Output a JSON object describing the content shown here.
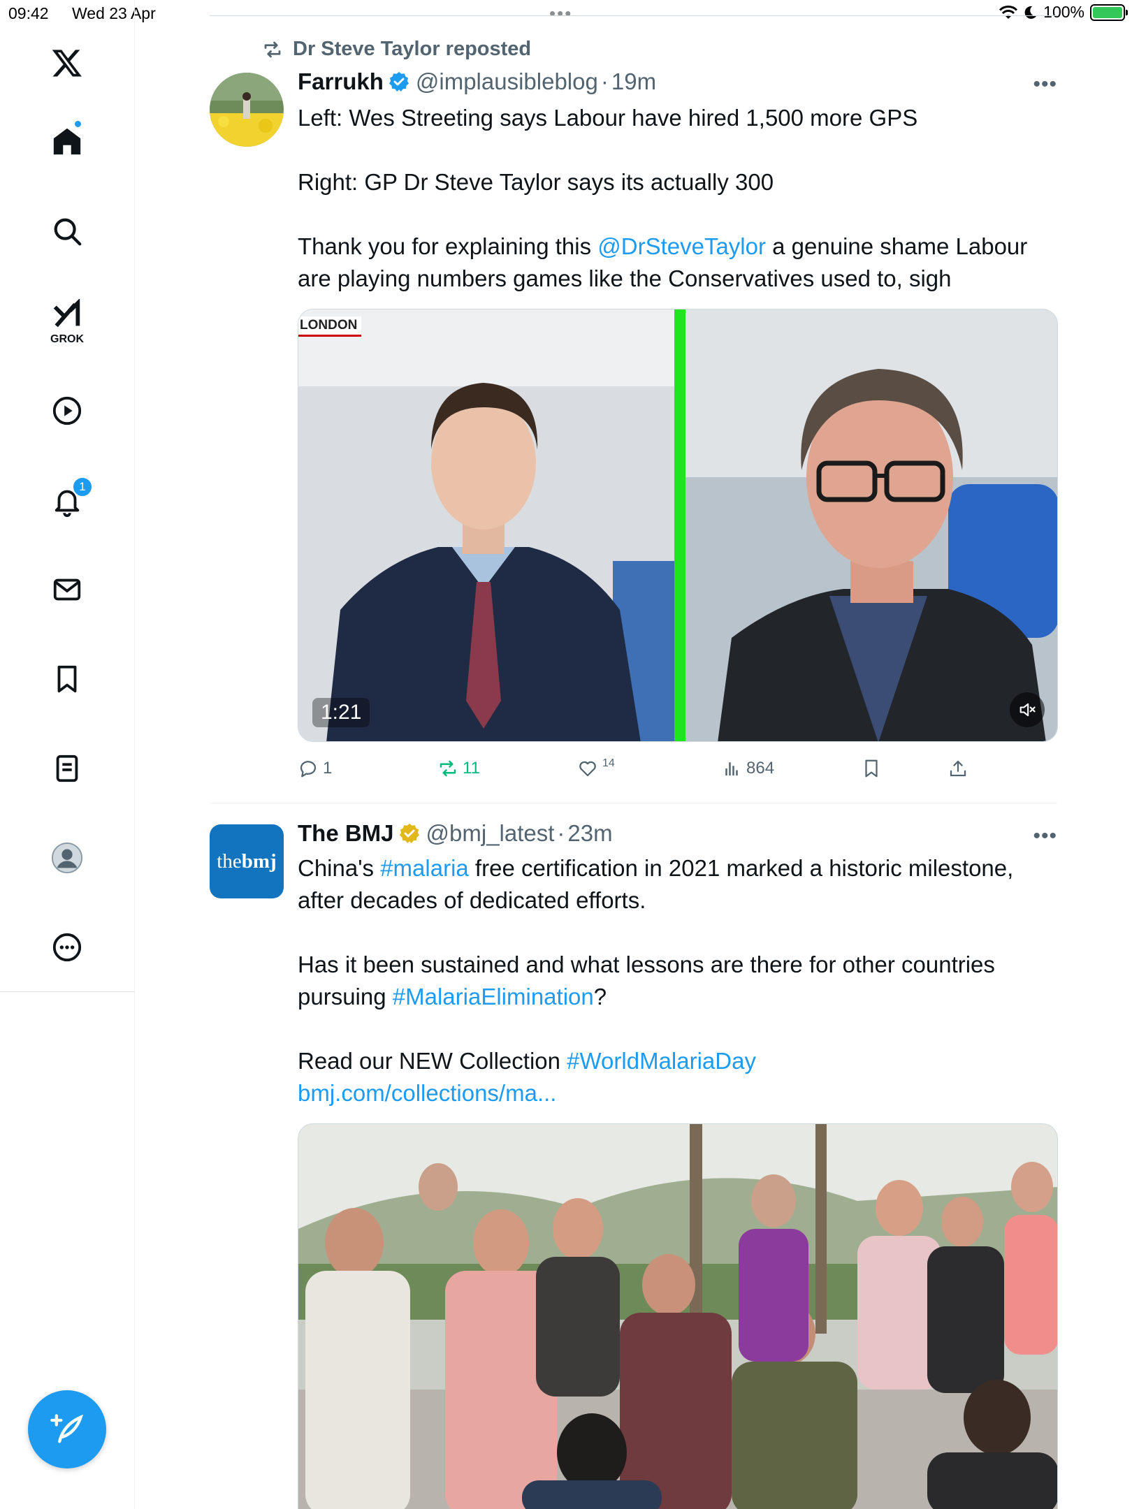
{
  "status": {
    "time": "09:42",
    "date": "Wed 23 Apr",
    "battery": "100%",
    "multitask_dots": "•••"
  },
  "sidebar": {
    "grok_label": "GROK",
    "notifications_badge": "1",
    "items": [
      "x-logo",
      "home",
      "search",
      "grok",
      "videos",
      "notifications",
      "messages",
      "bookmarks",
      "lists",
      "profile",
      "more"
    ]
  },
  "tweets": [
    {
      "repost_by": "Dr Steve Taylor reposted",
      "name": "Farrukh",
      "handle": "@implausibleblog",
      "dot": "·",
      "time": "19m",
      "more": "•••",
      "paragraphs": [
        {
          "text": "Left: Wes Streeting says Labour have hired 1,500 more GPS"
        },
        {
          "text": ""
        },
        {
          "text": "Right: GP Dr Steve Taylor says its actually 300"
        },
        {
          "text": ""
        },
        {
          "pre": "Thank you for explaining this ",
          "link": "@DrSteveTaylor",
          "post": " a genuine shame Labour are playing numbers games like the Conservatives used to, sigh"
        }
      ],
      "video": {
        "duration": "1:21",
        "overlay_label": "LONDON"
      },
      "stats": {
        "replies": "1",
        "reposts": "11",
        "likes": "14",
        "views": "864"
      }
    },
    {
      "name": "The BMJ",
      "handle": "@bmj_latest",
      "dot": "·",
      "time": "23m",
      "more": "•••",
      "avatar_text_a": "the",
      "avatar_text_b": "bmj",
      "line1_pre": "China's ",
      "line1_link": "#malaria",
      "line1_post": " free certification in 2021 marked a historic milestone, after decades of dedicated efforts.",
      "line2_pre": "Has it been sustained and what lessons are there for other countries pursuing ",
      "line2_link": "#MalariaElimination",
      "line2_post": "?",
      "line3_pre": "Read our NEW Collection ",
      "line3_link": "#WorldMalariaDay",
      "url": "bmj.com/collections/ma..."
    }
  ],
  "colors": {
    "accent": "#1d9bf0",
    "repost_green": "#00ba7c",
    "secondary_text": "#536471"
  }
}
